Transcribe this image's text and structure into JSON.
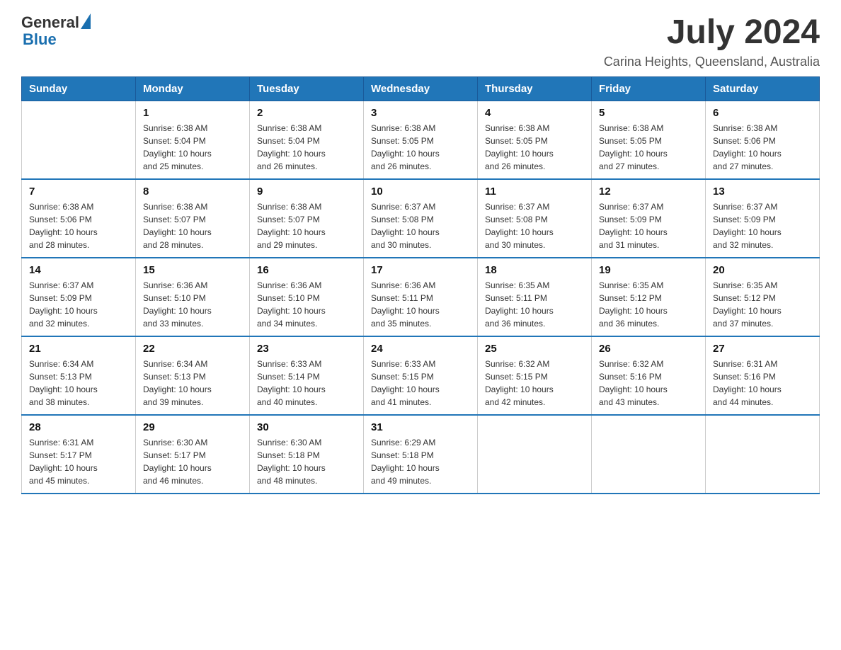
{
  "logo": {
    "general": "General",
    "blue": "Blue"
  },
  "header": {
    "month_year": "July 2024",
    "location": "Carina Heights, Queensland, Australia"
  },
  "days_of_week": [
    "Sunday",
    "Monday",
    "Tuesday",
    "Wednesday",
    "Thursday",
    "Friday",
    "Saturday"
  ],
  "weeks": [
    [
      {
        "num": "",
        "info": ""
      },
      {
        "num": "1",
        "info": "Sunrise: 6:38 AM\nSunset: 5:04 PM\nDaylight: 10 hours\nand 25 minutes."
      },
      {
        "num": "2",
        "info": "Sunrise: 6:38 AM\nSunset: 5:04 PM\nDaylight: 10 hours\nand 26 minutes."
      },
      {
        "num": "3",
        "info": "Sunrise: 6:38 AM\nSunset: 5:05 PM\nDaylight: 10 hours\nand 26 minutes."
      },
      {
        "num": "4",
        "info": "Sunrise: 6:38 AM\nSunset: 5:05 PM\nDaylight: 10 hours\nand 26 minutes."
      },
      {
        "num": "5",
        "info": "Sunrise: 6:38 AM\nSunset: 5:05 PM\nDaylight: 10 hours\nand 27 minutes."
      },
      {
        "num": "6",
        "info": "Sunrise: 6:38 AM\nSunset: 5:06 PM\nDaylight: 10 hours\nand 27 minutes."
      }
    ],
    [
      {
        "num": "7",
        "info": "Sunrise: 6:38 AM\nSunset: 5:06 PM\nDaylight: 10 hours\nand 28 minutes."
      },
      {
        "num": "8",
        "info": "Sunrise: 6:38 AM\nSunset: 5:07 PM\nDaylight: 10 hours\nand 28 minutes."
      },
      {
        "num": "9",
        "info": "Sunrise: 6:38 AM\nSunset: 5:07 PM\nDaylight: 10 hours\nand 29 minutes."
      },
      {
        "num": "10",
        "info": "Sunrise: 6:37 AM\nSunset: 5:08 PM\nDaylight: 10 hours\nand 30 minutes."
      },
      {
        "num": "11",
        "info": "Sunrise: 6:37 AM\nSunset: 5:08 PM\nDaylight: 10 hours\nand 30 minutes."
      },
      {
        "num": "12",
        "info": "Sunrise: 6:37 AM\nSunset: 5:09 PM\nDaylight: 10 hours\nand 31 minutes."
      },
      {
        "num": "13",
        "info": "Sunrise: 6:37 AM\nSunset: 5:09 PM\nDaylight: 10 hours\nand 32 minutes."
      }
    ],
    [
      {
        "num": "14",
        "info": "Sunrise: 6:37 AM\nSunset: 5:09 PM\nDaylight: 10 hours\nand 32 minutes."
      },
      {
        "num": "15",
        "info": "Sunrise: 6:36 AM\nSunset: 5:10 PM\nDaylight: 10 hours\nand 33 minutes."
      },
      {
        "num": "16",
        "info": "Sunrise: 6:36 AM\nSunset: 5:10 PM\nDaylight: 10 hours\nand 34 minutes."
      },
      {
        "num": "17",
        "info": "Sunrise: 6:36 AM\nSunset: 5:11 PM\nDaylight: 10 hours\nand 35 minutes."
      },
      {
        "num": "18",
        "info": "Sunrise: 6:35 AM\nSunset: 5:11 PM\nDaylight: 10 hours\nand 36 minutes."
      },
      {
        "num": "19",
        "info": "Sunrise: 6:35 AM\nSunset: 5:12 PM\nDaylight: 10 hours\nand 36 minutes."
      },
      {
        "num": "20",
        "info": "Sunrise: 6:35 AM\nSunset: 5:12 PM\nDaylight: 10 hours\nand 37 minutes."
      }
    ],
    [
      {
        "num": "21",
        "info": "Sunrise: 6:34 AM\nSunset: 5:13 PM\nDaylight: 10 hours\nand 38 minutes."
      },
      {
        "num": "22",
        "info": "Sunrise: 6:34 AM\nSunset: 5:13 PM\nDaylight: 10 hours\nand 39 minutes."
      },
      {
        "num": "23",
        "info": "Sunrise: 6:33 AM\nSunset: 5:14 PM\nDaylight: 10 hours\nand 40 minutes."
      },
      {
        "num": "24",
        "info": "Sunrise: 6:33 AM\nSunset: 5:15 PM\nDaylight: 10 hours\nand 41 minutes."
      },
      {
        "num": "25",
        "info": "Sunrise: 6:32 AM\nSunset: 5:15 PM\nDaylight: 10 hours\nand 42 minutes."
      },
      {
        "num": "26",
        "info": "Sunrise: 6:32 AM\nSunset: 5:16 PM\nDaylight: 10 hours\nand 43 minutes."
      },
      {
        "num": "27",
        "info": "Sunrise: 6:31 AM\nSunset: 5:16 PM\nDaylight: 10 hours\nand 44 minutes."
      }
    ],
    [
      {
        "num": "28",
        "info": "Sunrise: 6:31 AM\nSunset: 5:17 PM\nDaylight: 10 hours\nand 45 minutes."
      },
      {
        "num": "29",
        "info": "Sunrise: 6:30 AM\nSunset: 5:17 PM\nDaylight: 10 hours\nand 46 minutes."
      },
      {
        "num": "30",
        "info": "Sunrise: 6:30 AM\nSunset: 5:18 PM\nDaylight: 10 hours\nand 48 minutes."
      },
      {
        "num": "31",
        "info": "Sunrise: 6:29 AM\nSunset: 5:18 PM\nDaylight: 10 hours\nand 49 minutes."
      },
      {
        "num": "",
        "info": ""
      },
      {
        "num": "",
        "info": ""
      },
      {
        "num": "",
        "info": ""
      }
    ]
  ]
}
